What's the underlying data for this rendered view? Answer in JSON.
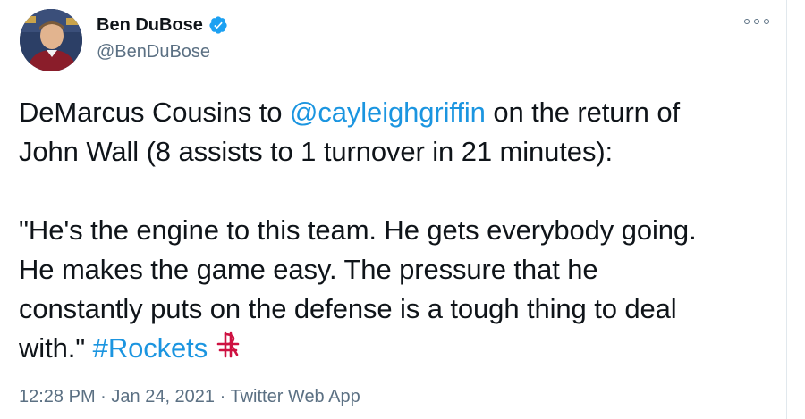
{
  "author": {
    "display_name": "Ben DuBose",
    "handle": "@BenDuBose",
    "verified": true
  },
  "icons": {
    "verified": "verified-badge-icon",
    "more": "more-options-icon",
    "emoji": "houston-rockets-logo-icon",
    "accent": "#1da1f2"
  },
  "tweet": {
    "line1_before": "DeMarcus Cousins to ",
    "mention": "@cayleighgriffin",
    "line1_after": " on the return of",
    "line2": "John Wall (8 assists to 1 turnover in 21 minutes):",
    "quote_line1": "\"He's the engine to this team. He gets everybody going.",
    "quote_line2": "He makes the game easy. The pressure that he",
    "quote_line3": "constantly puts on the defense is a tough thing to deal",
    "quote_line4_before": "with.\" ",
    "hashtag": "#Rockets"
  },
  "meta": {
    "time": "12:28 PM",
    "separator1": " · ",
    "date": "Jan 24, 2021",
    "separator2": " · ",
    "source": "Twitter Web App"
  }
}
